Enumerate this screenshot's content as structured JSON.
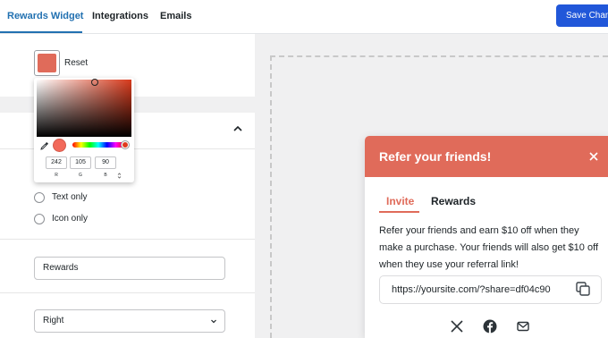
{
  "topbar": {
    "tabs": [
      "Rewards Widget",
      "Integrations",
      "Emails"
    ],
    "save_label": "Save Changes"
  },
  "left": {
    "reset_label": "Reset",
    "color_picker": {
      "color_hex": "#f2695a",
      "r": "242",
      "g": "105",
      "b": "90",
      "r_label": "R",
      "g_label": "G",
      "b_label": "B"
    },
    "radio_options": [
      "Text only",
      "Icon only"
    ],
    "label_value": "Rewards",
    "position_value": "Right"
  },
  "widget": {
    "title": "Refer your friends!",
    "accent_color": "#e06b5a",
    "tabs": [
      "Invite",
      "Rewards"
    ],
    "body_text": "Refer your friends and earn $10 off when they make a purchase. Your friends will also get $10 off when they use your referral link!",
    "share_link": "https://yoursite.com/?share=df04c90",
    "share_icons": [
      "x-icon",
      "facebook-icon",
      "email-icon"
    ]
  }
}
